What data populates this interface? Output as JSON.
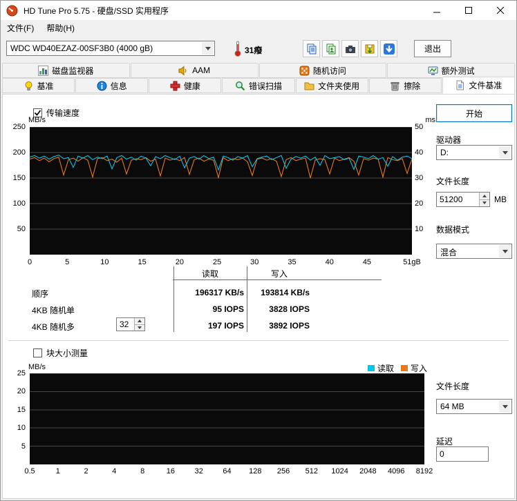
{
  "window": {
    "title": "HD Tune Pro 5.75 - 硬盘/SSD 实用程序"
  },
  "menu": {
    "items": [
      {
        "label": "文件(F)"
      },
      {
        "label": "帮助(H)"
      }
    ]
  },
  "toolbar": {
    "drive_select": "WDC WD40EZAZ-00SF3B0 (4000 gB)",
    "temperature": "31癈",
    "exit_label": "退出",
    "icons": [
      "copy-text-icon",
      "copy-image-icon",
      "screenshot-icon",
      "save-results-icon",
      "download-icon"
    ]
  },
  "tabs": {
    "row1": [
      {
        "label": "磁盘监视器"
      },
      {
        "label": "AAM"
      },
      {
        "label": "随机访问"
      },
      {
        "label": "额外测试"
      }
    ],
    "row2": [
      {
        "label": "基准"
      },
      {
        "label": "信息"
      },
      {
        "label": "健康"
      },
      {
        "label": "错误扫描"
      },
      {
        "label": "文件夹使用"
      },
      {
        "label": "擦除"
      },
      {
        "label": "文件基准",
        "active": true
      }
    ]
  },
  "benchmark": {
    "transfer_checkbox": "传输速度",
    "block_checkbox": "块大小测量",
    "legend": {
      "read": "读取",
      "write": "写入"
    },
    "results": {
      "col_read": "读取",
      "col_write": "写入",
      "rows": [
        {
          "label": "顺序",
          "read": "196317 KB/s",
          "write": "193814 KB/s"
        },
        {
          "label": "4KB 随机单",
          "read": "95 IOPS",
          "write": "3828 IOPS"
        },
        {
          "label": "4KB 随机多",
          "queue": "32",
          "read": "197 IOPS",
          "write": "3892 IOPS"
        }
      ]
    }
  },
  "sidebar": {
    "start_button": "开始",
    "drive_label": "驱动器",
    "drive_value": "D:",
    "filelen_label": "文件长度",
    "filelen_value": "51200",
    "filelen_unit": "MB",
    "datamode_label": "数据模式",
    "datamode_value": "混合",
    "filelen2_label": "文件长度",
    "filelen2_value": "64 MB",
    "delay_label": "延迟",
    "delay_value": "0"
  },
  "colors": {
    "read": "#00c6e8",
    "write": "#e87818",
    "chart_bg": "#0a0a0a",
    "grid": "#4a4a4a"
  },
  "chart_data": [
    {
      "type": "line",
      "name": "transfer-speed",
      "y_left_label": "MB/s",
      "y_right_label": "ms",
      "y_left_ticks": [
        250,
        200,
        150,
        100,
        50
      ],
      "y_right_ticks": [
        50,
        40,
        30,
        20,
        10
      ],
      "ylim": [
        0,
        250
      ],
      "ylim_right": [
        0,
        50
      ],
      "xmax": 51,
      "x_ticks": [
        "0",
        "5",
        "10",
        "15",
        "20",
        "25",
        "30",
        "35",
        "40",
        "45",
        "51gB"
      ],
      "series": [
        {
          "name": "读取",
          "color": "#00c6e8",
          "values": [
            191,
            194,
            189,
            193,
            187,
            192,
            195,
            188,
            190,
            171,
            193,
            189,
            194,
            186,
            191,
            188,
            193,
            168,
            190,
            194,
            187,
            191,
            185,
            193,
            189,
            174,
            192,
            188,
            194,
            190,
            186,
            193,
            170,
            189,
            192,
            187,
            194,
            188,
            191,
            166,
            193,
            190,
            185,
            192,
            189,
            194,
            172,
            188,
            191,
            193,
            186,
            190,
            194,
            169,
            187,
            192,
            189,
            193,
            185,
            191,
            175,
            194,
            188,
            190,
            192,
            186,
            189,
            167,
            193,
            191,
            188,
            194,
            187,
            190,
            173,
            192,
            185,
            191,
            193,
            188
          ]
        },
        {
          "name": "写入",
          "color": "#e87818",
          "values": [
            187,
            190,
            184,
            189,
            182,
            188,
            191,
            156,
            186,
            189,
            183,
            190,
            185,
            152,
            188,
            190,
            184,
            187,
            181,
            189,
            158,
            185,
            188,
            186,
            190,
            183,
            187,
            154,
            189,
            185,
            188,
            184,
            190,
            157,
            186,
            189,
            183,
            187,
            185,
            151,
            190,
            184,
            188,
            186,
            189,
            182,
            155,
            187,
            189,
            185,
            188,
            183,
            153,
            186,
            190,
            184,
            187,
            189,
            150,
            185,
            188,
            186,
            158,
            189,
            184,
            187,
            190,
            183,
            156,
            188,
            185,
            189,
            187,
            152,
            190,
            186,
            184,
            188,
            159,
            187
          ]
        }
      ]
    },
    {
      "type": "line",
      "name": "block-size",
      "y_label": "MB/s",
      "y_ticks": [
        25,
        20,
        15,
        10,
        5
      ],
      "ylim": [
        0,
        25
      ],
      "x_ticks": [
        "0.5",
        "1",
        "2",
        "4",
        "8",
        "16",
        "32",
        "64",
        "128",
        "256",
        "512",
        "1024",
        "2048",
        "4096",
        "8192"
      ],
      "series": []
    }
  ]
}
